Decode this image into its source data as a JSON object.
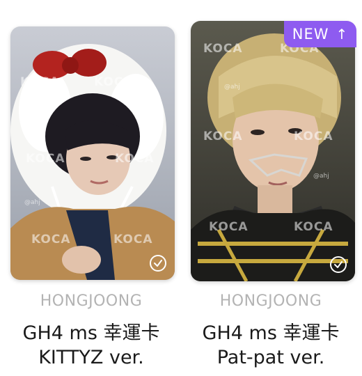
{
  "cards": [
    {
      "artist": "HONGJOONG",
      "title_line1": "GH4 ms 幸運卡",
      "title_line2": "KITTYZ ver.",
      "watermark": "KOCA",
      "credit": "@ahj",
      "check_icon": "check-circle-icon",
      "owned": true
    },
    {
      "artist": "HONGJOONG",
      "title_line1": "GH4 ms 幸運卡",
      "title_line2": "Pat-pat ver.",
      "watermark": "KOCA",
      "credit": "@ahj",
      "check_icon": "check-circle-icon",
      "owned": true,
      "badge": {
        "label": "NEW",
        "icon": "arrow-up-icon",
        "color": "#8e5bf0"
      }
    }
  ],
  "colors": {
    "badge": "#8e5bf0",
    "artist_text": "#b3b3b3",
    "title_text": "#1a1a1a"
  }
}
